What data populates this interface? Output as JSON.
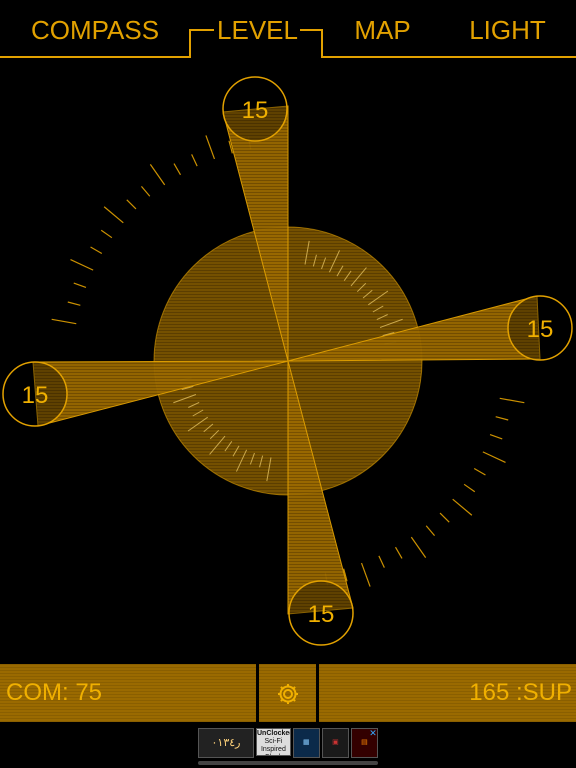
{
  "tabs": [
    {
      "id": "compass",
      "label": "COMPASS"
    },
    {
      "id": "level",
      "label": "LEVEL",
      "active": true
    },
    {
      "id": "map",
      "label": "MAP"
    },
    {
      "id": "light",
      "label": "LIGHT"
    }
  ],
  "level": {
    "readings": {
      "top": "15",
      "right": "15",
      "bottom": "15",
      "left": "15"
    }
  },
  "footer": {
    "com_label": "COM: 75",
    "settings_icon": "gear-icon",
    "sup_label": "165 :SUP"
  },
  "ad": {
    "main": "ﺭ٠١٣٤",
    "title": "UnClocked",
    "subtitle": "Sci-Fi Inspired Clock Widget",
    "close_icon": "close-icon"
  },
  "colors": {
    "accent": "#e2a100",
    "panel": "#9a6a00",
    "background": "#000000"
  }
}
